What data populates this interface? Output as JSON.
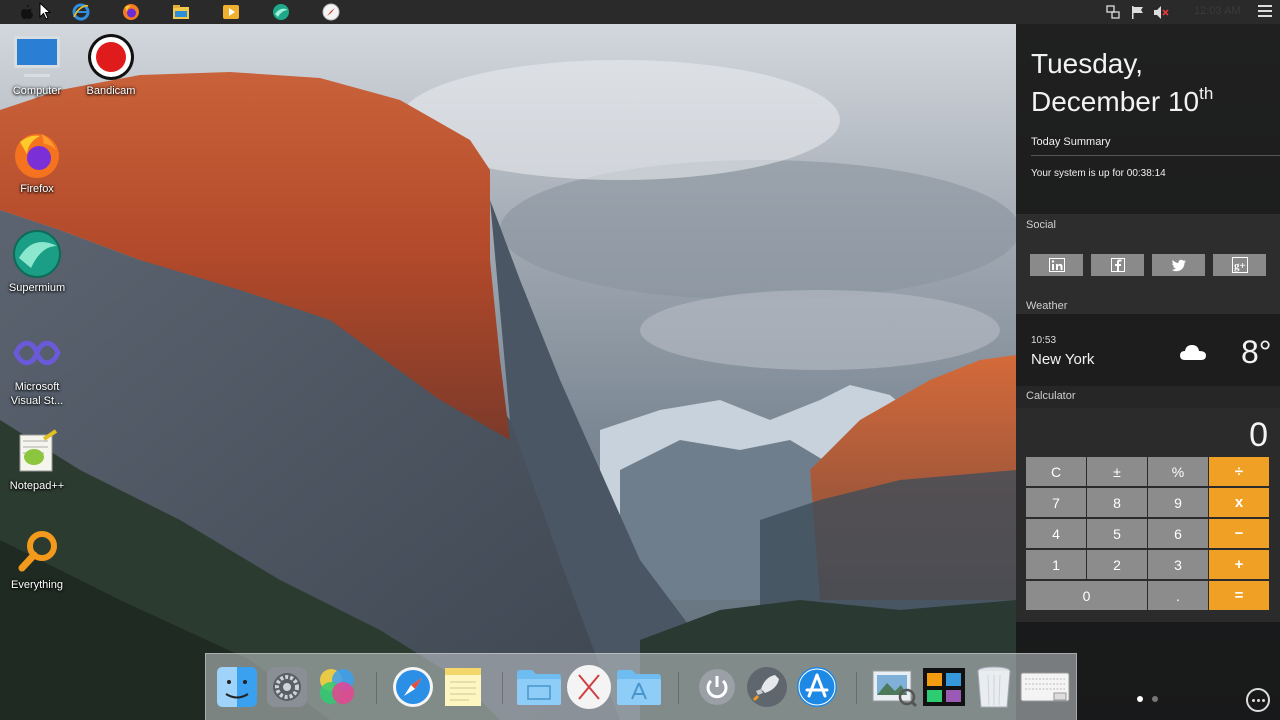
{
  "topbar": {
    "apps": [
      "apple-icon",
      "ie-icon",
      "firefox-icon",
      "file-explorer-icon",
      "media-player-icon",
      "supermium-icon",
      "safari-compass-icon"
    ],
    "tray": [
      "network-icon",
      "flag-icon",
      "volume-muted-icon"
    ],
    "clock": "12:03 AM"
  },
  "desktop": {
    "icons": [
      {
        "label": "Computer"
      },
      {
        "label": "Bandicam"
      },
      {
        "label": "Firefox"
      },
      {
        "label": "Supermium"
      },
      {
        "label": "Microsoft Visual St..."
      },
      {
        "label": "Notepad++"
      },
      {
        "label": "Everything"
      }
    ]
  },
  "panel": {
    "date_line1": "Tuesday,",
    "date_line2": "December 10",
    "date_suffix": "th",
    "summary_title": "Today Summary",
    "summary_text": "Your system is up for 00:38:14",
    "social_title": "Social",
    "social_buttons": [
      "in",
      "f",
      "t",
      "g+"
    ],
    "weather_title": "Weather",
    "weather": {
      "time": "10:53",
      "city": "New York",
      "temp": "8°",
      "icon": "cloud-icon"
    },
    "calc_title": "Calculator",
    "calc_display": "0",
    "calc_keys": [
      [
        "C",
        "±",
        "%",
        "÷"
      ],
      [
        "7",
        "8",
        "9",
        "x"
      ],
      [
        "4",
        "5",
        "6",
        "−"
      ],
      [
        "1",
        "2",
        "3",
        "+"
      ],
      [
        "0",
        ".",
        "="
      ]
    ]
  },
  "dock": {
    "items": [
      "finder-icon",
      "system-preferences-icon",
      "game-center-icon",
      "safari-icon",
      "notes-icon",
      "folder-icon",
      "x-window-icon",
      "applications-folder-icon",
      "power-icon",
      "launchpad-icon",
      "app-store-icon",
      "preview-icon",
      "photo-gallery-icon",
      "trash-icon",
      "keyboard-viewer-icon"
    ]
  },
  "colors": {
    "calc_operator": "#f0a024",
    "calc_key": "#8c8c8c",
    "panel_bg": "#141414"
  }
}
